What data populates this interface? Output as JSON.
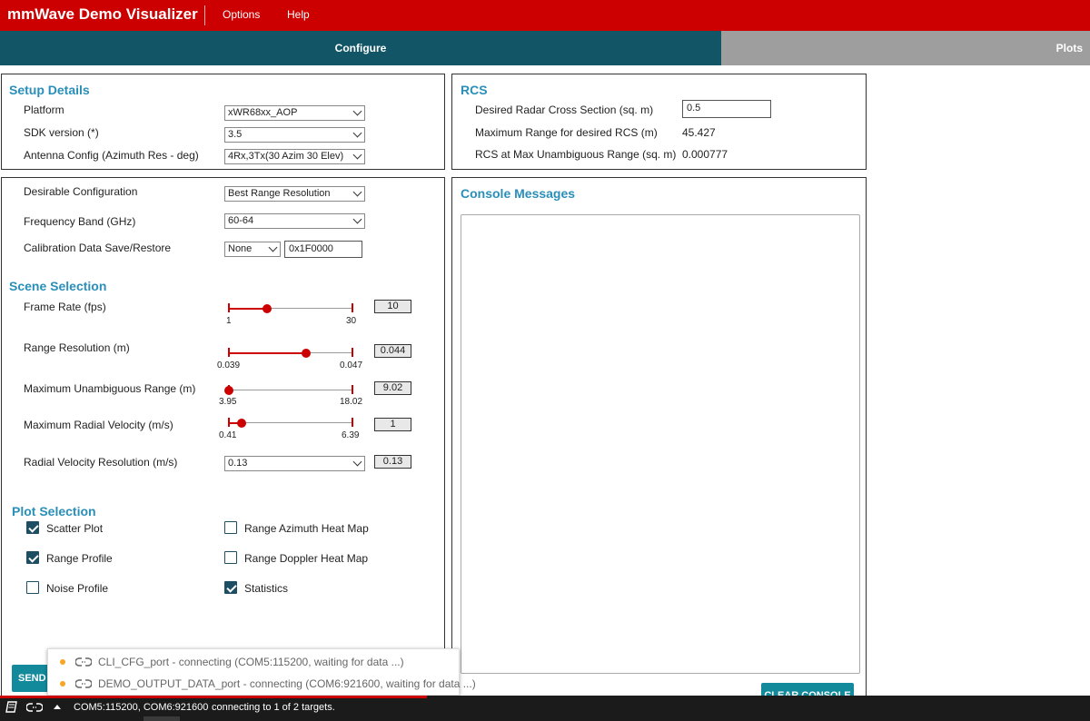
{
  "app": {
    "title": "mmWave Demo Visualizer"
  },
  "menu": {
    "options": "Options",
    "help": "Help"
  },
  "tabs": {
    "configure": "Configure",
    "plots": "Plots"
  },
  "setup": {
    "title": "Setup Details",
    "platform": {
      "label": "Platform",
      "value": "xWR68xx_AOP"
    },
    "sdk": {
      "label": "SDK version (*)",
      "value": "3.5"
    },
    "antenna": {
      "label": "Antenna Config (Azimuth Res - deg)",
      "value": "4Rx,3Tx(30 Azim 30 Elev)"
    }
  },
  "rcs": {
    "title": "RCS",
    "desired": {
      "label": "Desired Radar Cross Section (sq. m)",
      "value": "0.5"
    },
    "max_range": {
      "label": "Maximum Range for desired RCS (m)",
      "value": "45.427"
    },
    "at_max": {
      "label": "RCS at Max Unambiguous Range (sq. m)",
      "value": "0.000777"
    }
  },
  "config": {
    "desirable": {
      "label": "Desirable Configuration",
      "value": "Best Range Resolution"
    },
    "band": {
      "label": "Frequency Band (GHz)",
      "value": "60-64"
    },
    "calib": {
      "label": "Calibration Data Save/Restore",
      "mode": "None",
      "address": "0x1F0000"
    }
  },
  "scene": {
    "title": "Scene Selection",
    "frame_rate": {
      "label": "Frame Rate (fps)",
      "min": "1",
      "max": "30",
      "value": "10",
      "level": 0.31
    },
    "range_res": {
      "label": "Range Resolution (m)",
      "min": "0.039",
      "max": "0.047",
      "value": "0.044",
      "level": 0.625
    },
    "max_range": {
      "label": "Maximum Unambiguous Range (m)",
      "min": "3.95",
      "max": "18.02",
      "value": "9.02",
      "level": 0.0
    },
    "max_vel": {
      "label": "Maximum Radial Velocity (m/s)",
      "min": "0.41",
      "max": "6.39",
      "value": "1",
      "level": 0.1
    },
    "vel_res": {
      "label": "Radial Velocity Resolution (m/s)",
      "option": "0.13",
      "value": "0.13"
    }
  },
  "plots": {
    "title": "Plot Selection",
    "scatter": {
      "label": "Scatter Plot",
      "checked": true
    },
    "range_profile": {
      "label": "Range Profile",
      "checked": true
    },
    "noise_profile": {
      "label": "Noise Profile",
      "checked": false
    },
    "range_azimuth": {
      "label": "Range Azimuth Heat Map",
      "checked": false
    },
    "range_doppler": {
      "label": "Range Doppler Heat Map",
      "checked": false
    },
    "statistics": {
      "label": "Statistics",
      "checked": true
    }
  },
  "console": {
    "title": "Console Messages",
    "clear_label": "CLEAR CONSOLE"
  },
  "send_label": "SEND C",
  "connections": {
    "cli": "CLI_CFG_port - connecting (COM5:115200, waiting for data ...)",
    "data": "DEMO_OUTPUT_DATA_port - connecting (COM6:921600, waiting for data ...)"
  },
  "status": {
    "ports": "COM5:115200, COM6:921600",
    "message": "connecting to 1 of 2 targets."
  },
  "colors": {
    "brand_red": "#cc0000",
    "tab_active": "#115566",
    "accent": "#2a8fb8",
    "connecting": "#f5a623"
  }
}
